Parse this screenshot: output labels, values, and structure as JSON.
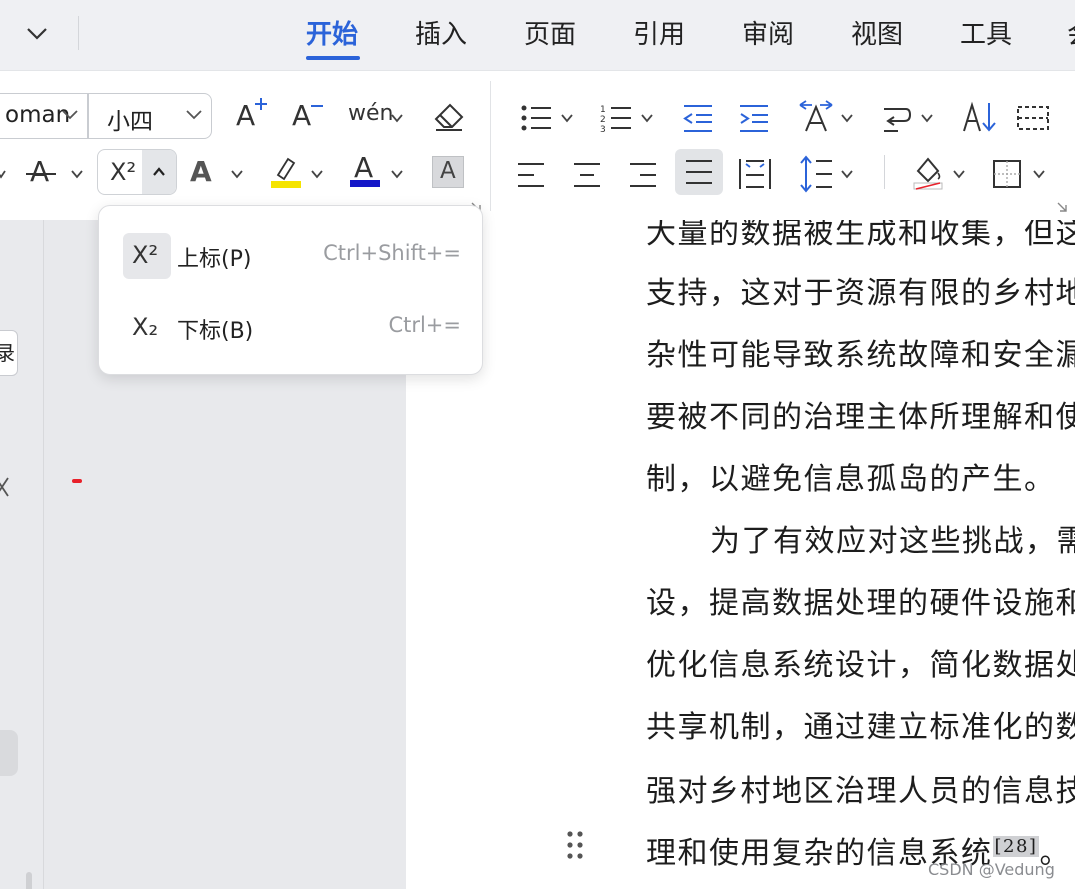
{
  "tabs": {
    "items": [
      {
        "label": "开始",
        "active": true
      },
      {
        "label": "插入"
      },
      {
        "label": "页面"
      },
      {
        "label": "引用"
      },
      {
        "label": "审阅"
      },
      {
        "label": "视图"
      },
      {
        "label": "工具"
      },
      {
        "label": "会"
      }
    ],
    "accent_color": "#2b63d9"
  },
  "ribbon": {
    "font_name": "oman",
    "font_size": "小四",
    "increase_font_glyph": "A",
    "decrease_font_glyph": "A",
    "pinyin_glyph": "wén",
    "strike_glyph": "A",
    "superscript_glyph": "X²",
    "text_effect_glyph": "A",
    "highlight_glyph": "A",
    "font_color_glyph": "A",
    "char_shading_glyph": "A",
    "highlight_color": "#f5e400",
    "font_color": "#1416c8"
  },
  "dropdown": {
    "items": [
      {
        "icon": "X²",
        "label": "上标(P)",
        "shortcut": "Ctrl+Shift+="
      },
      {
        "icon": "X₂",
        "label": "下标(B)",
        "shortcut": "Ctrl+="
      }
    ]
  },
  "side": {
    "tab_label": "录"
  },
  "document": {
    "lines": [
      "大量的数据被生成和收集，但这",
      "支持，这对于资源有限的乡村地",
      "杂性可能导致系统故障和安全漏",
      "要被不同的治理主体所理解和使",
      "制，以避免信息孤岛的产生。",
      "为了有效应对这些挑战，需",
      "设，提高数据处理的硬件设施和",
      "优化信息系统设计，简化数据处",
      "共享机制，通过建立标准化的数",
      "强对乡村地区治理人员的信息技",
      "理和使用复杂的信息系统"
    ],
    "citation": "[28]",
    "last_line_end": "。"
  },
  "watermark": "CSDN @Vedung"
}
